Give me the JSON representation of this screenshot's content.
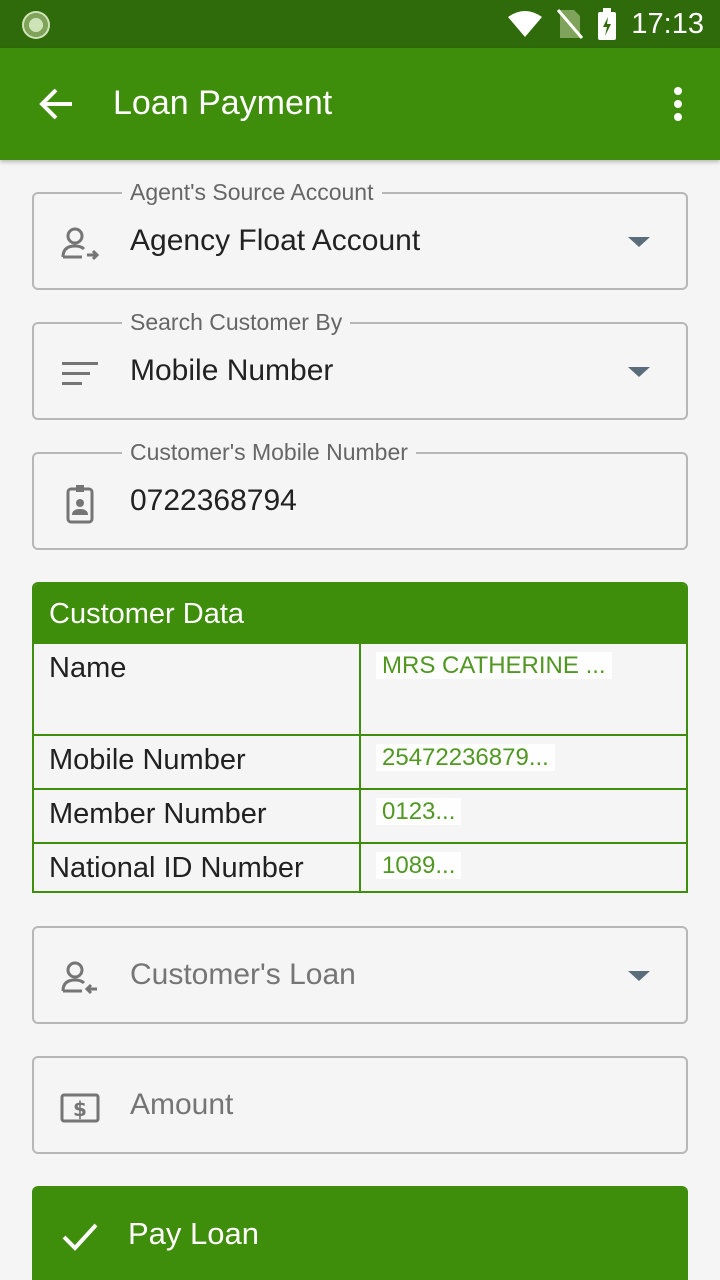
{
  "status_bar": {
    "time": "17:13"
  },
  "app_bar": {
    "title": "Loan Payment"
  },
  "fields": {
    "source_account": {
      "label": "Agent's Source Account",
      "value": "Agency Float Account"
    },
    "search_by": {
      "label": "Search Customer By",
      "value": "Mobile Number"
    },
    "mobile": {
      "label": "Customer's Mobile Number",
      "value": "0722368794"
    },
    "loan": {
      "placeholder": "Customer's Loan"
    },
    "amount": {
      "placeholder": "Amount"
    }
  },
  "customer_data": {
    "title": "Customer Data",
    "rows": [
      {
        "key": "Name",
        "value": "MRS CATHERINE ..."
      },
      {
        "key": "Mobile Number",
        "value": "25472236879..."
      },
      {
        "key": "Member Number",
        "value": "0123..."
      },
      {
        "key": "National ID Number",
        "value": "1089..."
      }
    ]
  },
  "action": {
    "pay_label": "Pay Loan"
  },
  "colors": {
    "primary": "#3f8e0b",
    "status_bar": "#2f6b0b",
    "border": "#b7b7b7"
  }
}
